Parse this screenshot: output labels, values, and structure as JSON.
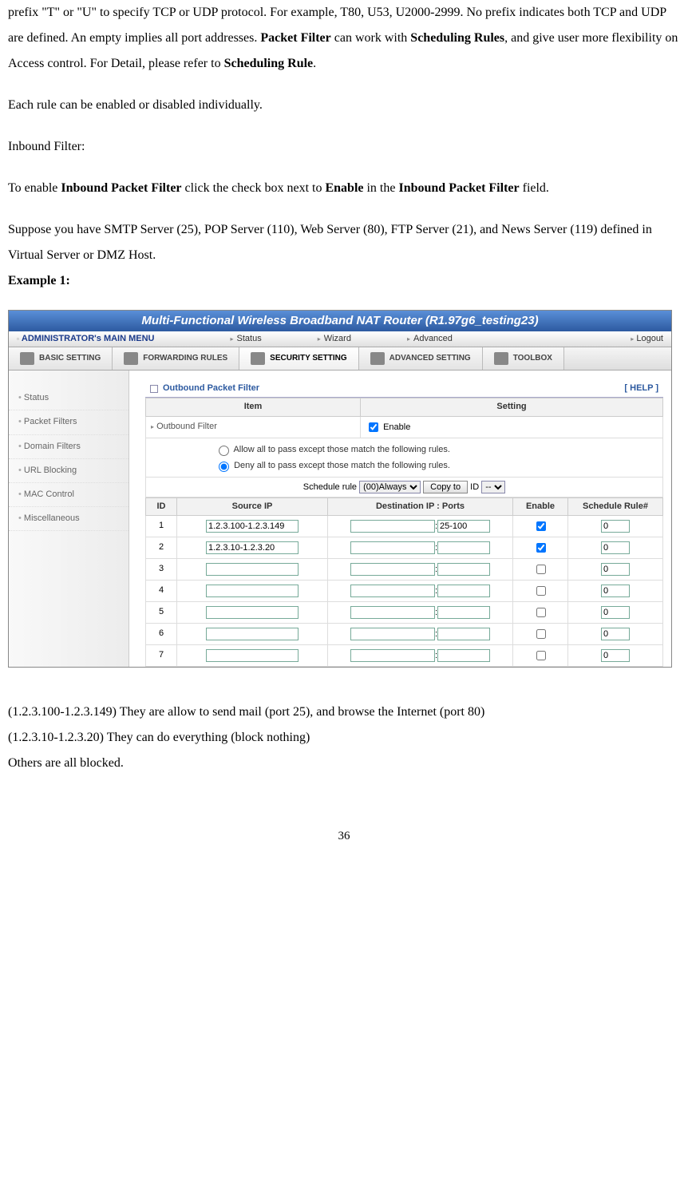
{
  "doc": {
    "para1_a": "prefix \"T\" or \"U\" to specify TCP or UDP protocol. For example, T80, U53, U2000-2999. No prefix indicates both TCP and UDP are defined. An empty implies all port addresses. ",
    "para1_b": "Packet Filter",
    "para1_c": " can work with ",
    "para1_d": "Scheduling Rules",
    "para1_e": ", and give user more flexibility on Access control. For Detail, please refer to ",
    "para1_f": "Scheduling Rule",
    "para1_g": ".",
    "para2": "Each rule can be enabled or disabled individually.",
    "para3": "Inbound Filter:",
    "para4_a": "To enable ",
    "para4_b": "Inbound Packet Filter",
    "para4_c": " click the check box next to ",
    "para4_d": "Enable",
    "para4_e": " in the ",
    "para4_f": "Inbound Packet Filter",
    "para4_g": " field.",
    "para5": "Suppose you have SMTP Server (25), POP Server (110), Web Server (80), FTP Server (21), and News Server (119) defined in Virtual Server or DMZ Host.",
    "example_label": "Example 1:",
    "after1": "(1.2.3.100-1.2.3.149) They are allow to send mail (port 25), and browse the Internet (port 80)",
    "after2": "(1.2.3.10-1.2.3.20) They can do everything (block nothing)",
    "after3": "Others are all blocked.",
    "page_number": "36"
  },
  "ui": {
    "titlebar": "Multi-Functional Wireless Broadband NAT Router (R1.97g6_testing23)",
    "menubar": {
      "admin": "ADMINISTRATOR's MAIN MENU",
      "status": "Status",
      "wizard": "Wizard",
      "advanced": "Advanced",
      "logout": "Logout"
    },
    "tabs": {
      "basic": "BASIC SETTING",
      "forwarding": "FORWARDING RULES",
      "security": "SECURITY SETTING",
      "advanced": "ADVANCED SETTING",
      "toolbox": "TOOLBOX"
    },
    "sidebar": [
      "Status",
      "Packet Filters",
      "Domain Filters",
      "URL Blocking",
      "MAC Control",
      "Miscellaneous"
    ],
    "panel": {
      "title": "Outbound Packet Filter",
      "help": "[ HELP ]",
      "col_item": "Item",
      "col_setting": "Setting",
      "outbound_label": "Outbound Filter",
      "enable_label": "Enable",
      "radio_allow": "Allow all to pass except those match the following rules.",
      "radio_deny": "Deny all to pass except those match the following rules.",
      "sched_label": "Schedule rule",
      "sched_value": "(00)Always",
      "copy_btn": "Copy to",
      "id_label": "ID",
      "id_value": "--"
    },
    "rules": {
      "h_id": "ID",
      "h_src": "Source IP",
      "h_dst": "Destination IP : Ports",
      "h_enable": "Enable",
      "h_sched": "Schedule Rule#",
      "rows": [
        {
          "id": "1",
          "src": "1.2.3.100-1.2.3.149",
          "dip": "",
          "dport": "25-100",
          "enable": true,
          "sched": "0"
        },
        {
          "id": "2",
          "src": "1.2.3.10-1.2.3.20",
          "dip": "",
          "dport": "",
          "enable": true,
          "sched": "0"
        },
        {
          "id": "3",
          "src": "",
          "dip": "",
          "dport": "",
          "enable": false,
          "sched": "0"
        },
        {
          "id": "4",
          "src": "",
          "dip": "",
          "dport": "",
          "enable": false,
          "sched": "0"
        },
        {
          "id": "5",
          "src": "",
          "dip": "",
          "dport": "",
          "enable": false,
          "sched": "0"
        },
        {
          "id": "6",
          "src": "",
          "dip": "",
          "dport": "",
          "enable": false,
          "sched": "0"
        },
        {
          "id": "7",
          "src": "",
          "dip": "",
          "dport": "",
          "enable": false,
          "sched": "0"
        }
      ]
    }
  }
}
